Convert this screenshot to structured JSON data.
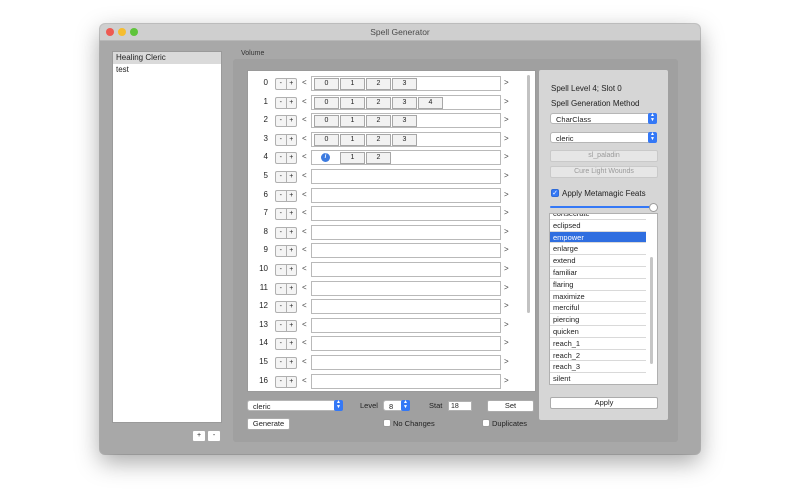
{
  "window": {
    "title": "Spell Generator"
  },
  "left_list": {
    "items": [
      {
        "label": "Healing Cleric",
        "selected": true
      },
      {
        "label": "test",
        "selected": false
      }
    ],
    "add_label": "+",
    "remove_label": "-"
  },
  "volume_label": "Volume",
  "levels": [
    {
      "num": "0",
      "slots": [
        "0",
        "1",
        "2",
        "3"
      ]
    },
    {
      "num": "1",
      "slots": [
        "0",
        "1",
        "2",
        "3",
        "4"
      ]
    },
    {
      "num": "2",
      "slots": [
        "0",
        "1",
        "2",
        "3"
      ]
    },
    {
      "num": "3",
      "slots": [
        "0",
        "1",
        "2",
        "3"
      ]
    },
    {
      "num": "4",
      "slots": [
        "i",
        "1",
        "2"
      ]
    },
    {
      "num": "5",
      "slots": []
    },
    {
      "num": "6",
      "slots": []
    },
    {
      "num": "7",
      "slots": []
    },
    {
      "num": "8",
      "slots": []
    },
    {
      "num": "9",
      "slots": []
    },
    {
      "num": "10",
      "slots": []
    },
    {
      "num": "11",
      "slots": []
    },
    {
      "num": "12",
      "slots": []
    },
    {
      "num": "13",
      "slots": []
    },
    {
      "num": "14",
      "slots": []
    },
    {
      "num": "15",
      "slots": []
    },
    {
      "num": "16",
      "slots": []
    }
  ],
  "controls": {
    "minus": "-",
    "plus": "+",
    "left_arrow": "<",
    "right_arrow": ">"
  },
  "bottom": {
    "class_value": "cleric",
    "level_label": "Level",
    "level_value": "8",
    "stat_label": "Stat",
    "stat_value": "18",
    "set_label": "Set",
    "generate_label": "Generate",
    "no_changes_label": "No Changes",
    "duplicates_label": "Duplicates"
  },
  "right_panel": {
    "slot_info": "Spell Level 4; Slot 0",
    "method_label": "Spell Generation Method",
    "method_value": "CharClass",
    "class_value": "cleric",
    "list_button": "sl_paladin",
    "spell_button": "Cure Light Wounds",
    "metamagic_label": "Apply Metamagic Feats",
    "metamagic_checked": true,
    "metamagic_items": [
      "consecrate",
      "eclipsed",
      "empower",
      "enlarge",
      "extend",
      "familiar",
      "flaring",
      "maximize",
      "merciful",
      "piercing",
      "quicken",
      "reach_1",
      "reach_2",
      "reach_3",
      "silent"
    ],
    "selected_index": 2,
    "apply_label": "Apply"
  },
  "colors": {
    "accent": "#3478f6",
    "selection": "#2f6ee0"
  }
}
